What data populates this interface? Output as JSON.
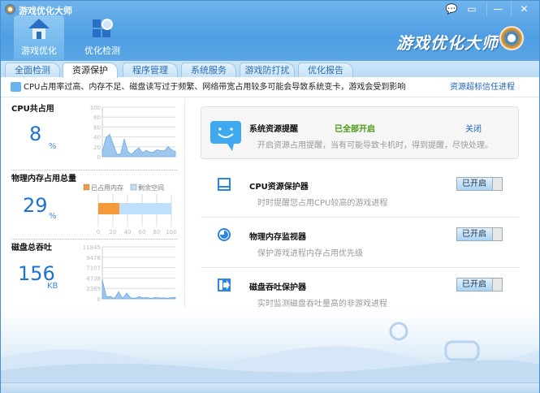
{
  "window": {
    "title": "游戏优化大师",
    "brand": "游戏优化大师",
    "controls": [
      "feedback",
      "skin",
      "minimize",
      "close"
    ]
  },
  "nav": [
    {
      "label": "游戏优化",
      "icon": "home-icon",
      "active": true
    },
    {
      "label": "优化检测",
      "icon": "scan-icon",
      "active": false
    }
  ],
  "tabs": [
    {
      "label": "全面检测"
    },
    {
      "label": "资源保护",
      "active": true
    },
    {
      "label": "程序管理"
    },
    {
      "label": "系统服务"
    },
    {
      "label": "游戏防打扰"
    },
    {
      "label": "优化报告"
    }
  ],
  "info": {
    "text": "CPU占用率过高、内存不足、磁盘读写过于频繁、网络带宽占用较多可能会导致系统变卡，游戏会受到影响",
    "link": "资源超标信任进程"
  },
  "cpu": {
    "title": "CPU共占用",
    "value": "8",
    "unit": "%"
  },
  "memory": {
    "title": "物理内存占用总量",
    "value": "29",
    "unit": "%",
    "legend": [
      "已占用内存",
      "剩余空间"
    ]
  },
  "disk": {
    "title": "磁盘总吞吐",
    "value": "156",
    "unit": "KB"
  },
  "chart_data": [
    {
      "type": "area",
      "ylim": [
        0,
        100
      ],
      "yticks": [
        "100",
        "80",
        "60",
        "40",
        "20",
        "0"
      ],
      "values": [
        10,
        38,
        45,
        25,
        5,
        5,
        35,
        10,
        5,
        12,
        18,
        8,
        13,
        9,
        9,
        14,
        12,
        12,
        20,
        14,
        10
      ],
      "color": "#9cc8f0"
    },
    {
      "type": "bar",
      "xlim": [
        0,
        100
      ],
      "xticks": [
        "0",
        "20",
        "40",
        "60",
        "80",
        "100"
      ],
      "series": [
        {
          "name": "已占用内存",
          "values": [
            29
          ],
          "color": "#f59a3a"
        },
        {
          "name": "剩余空间",
          "values": [
            71
          ],
          "color": "#bfe0fb"
        }
      ]
    },
    {
      "type": "area",
      "ylim": [
        0,
        11845
      ],
      "yticks": [
        "11845",
        "9476",
        "7107",
        "4738",
        "2369",
        "0"
      ],
      "values": [
        4300,
        500,
        500,
        100,
        1600,
        100,
        1300,
        200,
        100,
        500,
        200,
        300,
        100,
        300,
        200,
        200,
        100,
        300,
        300
      ],
      "color": "#9cc8f0"
    }
  ],
  "reminder": {
    "title": "系统资源提醒",
    "status": "已全部开启",
    "action": "关闭",
    "desc": "开启资源占用提醒，当有可能导致卡机时，得到提醒，尽快处理。",
    "status_color": "#4a9a12"
  },
  "protectors": [
    {
      "title": "CPU资源保护器",
      "desc": "时时提醒您占用CPU较高的游戏进程",
      "toggle": "已开启",
      "icon": "cpu-icon"
    },
    {
      "title": "物理内存监视器",
      "desc": "保护游戏进程内存占用优先级",
      "toggle": "已开启",
      "icon": "memory-pie-icon"
    },
    {
      "title": "磁盘吞吐保护器",
      "desc": "实时监测磁盘吞吐量高的非游戏进程",
      "toggle": "已开启",
      "icon": "disk-icon"
    }
  ]
}
